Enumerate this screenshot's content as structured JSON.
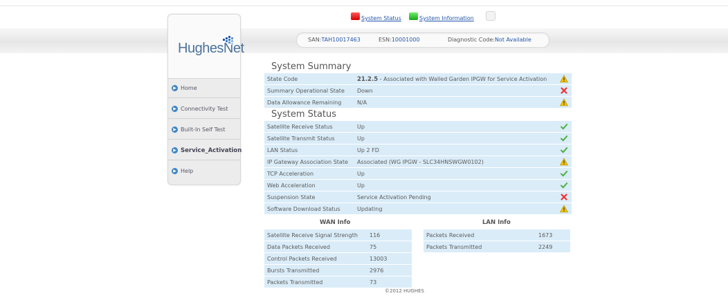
{
  "header": {
    "system_status_link": "System Status",
    "system_information_link": "System Information",
    "san_label": "SAN:",
    "san_value": "TAH10017463",
    "esn_label": "ESN:",
    "esn_value": "10001000",
    "diag_label": "Diagnostic Code:",
    "diag_value": "Not Available",
    "status_color": "#e00000",
    "info_color": "#22bb22"
  },
  "logo": {
    "text": "HughesNet",
    "mark": "."
  },
  "sidebar": {
    "items": [
      {
        "label": "Home",
        "active": false
      },
      {
        "label": "Connectivity Test",
        "active": false
      },
      {
        "label": "Built-In Self Test",
        "active": false
      },
      {
        "label": "Service_Activation",
        "active": true
      },
      {
        "label": "Help",
        "active": false
      }
    ]
  },
  "system_summary": {
    "title": "System Summary",
    "rows": [
      {
        "key": "State Code",
        "value_bold": "21.2.5",
        "value": " - Associated with Walled Garden IPGW for Service Activation",
        "status": "warning-icon"
      },
      {
        "key": "Summary Operational State",
        "value": "Down",
        "status": "error-icon"
      },
      {
        "key": "Data Allowance Remaining",
        "value": "N/A",
        "status": "warning-icon"
      }
    ]
  },
  "system_status": {
    "title": "System Status",
    "rows": [
      {
        "key": "Satellite Receive Status",
        "value": "Up",
        "status": "check-icon"
      },
      {
        "key": "Satellite Transmit Status",
        "value": "Up",
        "status": "check-icon"
      },
      {
        "key": "LAN Status",
        "value": "Up 2 FD",
        "status": "check-icon"
      },
      {
        "key": "IP Gateway Association State",
        "value": "Associated (WG IPGW - SLC34HNSWGW0102)",
        "status": "warning-icon"
      },
      {
        "key": "TCP Acceleration",
        "value": "Up",
        "status": "check-icon"
      },
      {
        "key": "Web Acceleration",
        "value": "Up",
        "status": "check-icon"
      },
      {
        "key": "Suspension State",
        "value": "Service Activation Pending",
        "status": "error-icon"
      },
      {
        "key": "Software Download Status",
        "value": "Updating",
        "status": "warning-icon"
      }
    ]
  },
  "wan_info": {
    "title": "WAN Info",
    "rows": [
      {
        "key": "Satellite Receive Signal Strength",
        "value": "116"
      },
      {
        "key": "Data Packets Received",
        "value": "75"
      },
      {
        "key": "Control Packets Received",
        "value": "13003"
      },
      {
        "key": "Bursts Transmitted",
        "value": "2976"
      },
      {
        "key": "Packets Transmitted",
        "value": "73"
      }
    ]
  },
  "lan_info": {
    "title": "LAN Info",
    "rows": [
      {
        "key": "Packets Received",
        "value": "1673"
      },
      {
        "key": "Packets Transmitted",
        "value": "2249"
      }
    ]
  },
  "footer": {
    "copyright": "©2012 HUGHES"
  }
}
